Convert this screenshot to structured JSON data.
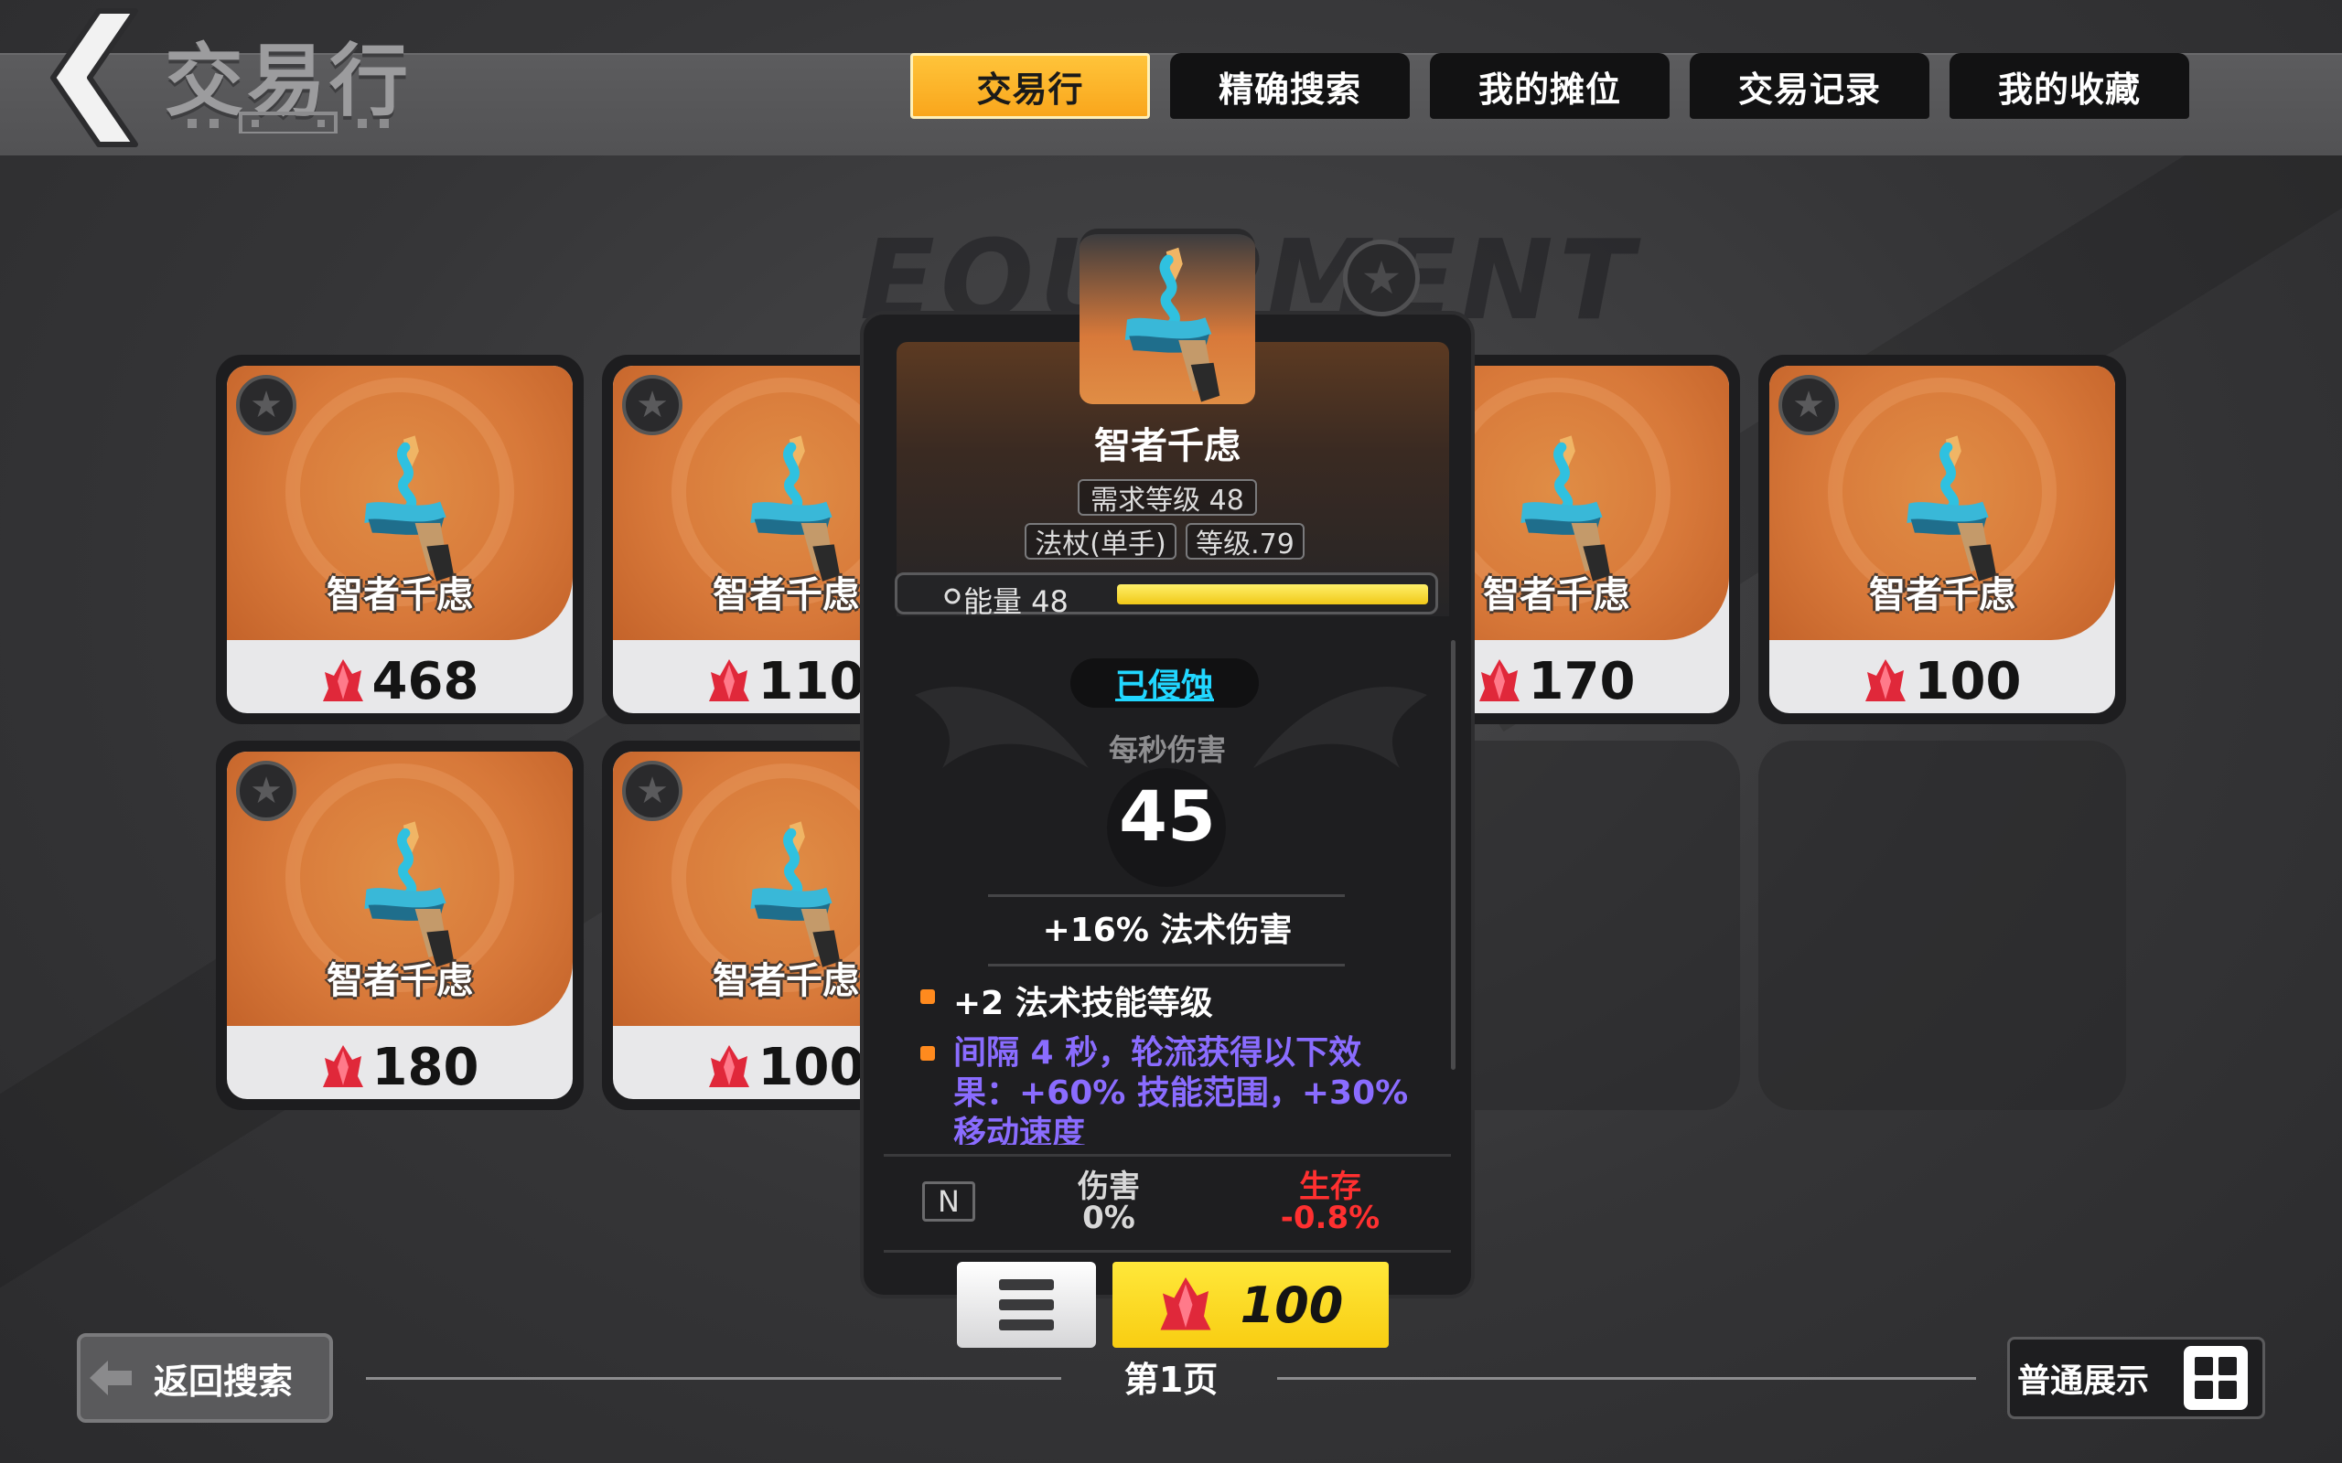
{
  "header": {
    "title": "交易行",
    "tabs": [
      {
        "label": "交易行",
        "active": true
      },
      {
        "label": "精确搜索",
        "active": false
      },
      {
        "label": "我的摊位",
        "active": false
      },
      {
        "label": "交易记录",
        "active": false
      },
      {
        "label": "我的收藏",
        "active": false
      }
    ]
  },
  "listings": [
    {
      "name": "智者千虑",
      "price": "468"
    },
    {
      "name": "智者千虑",
      "price": "110"
    },
    {
      "name": "智者千虑",
      "price": "170"
    },
    {
      "name": "智者千虑",
      "price": "100"
    },
    {
      "name": "智者千虑",
      "price": "180"
    },
    {
      "name": "智者千虑",
      "price": "100"
    }
  ],
  "detail": {
    "watermark": "EQUIPMENT",
    "name": "智者千虑",
    "required_level": "需求等级 48",
    "type": "法杖(单手)",
    "item_level": "等级.79",
    "energy_label": "能量 48",
    "energy_fraction": 0.95,
    "corrupted": "已侵蚀",
    "dps_label": "每秒伤害",
    "dps_value": "45",
    "main_stat": "+16% 法术伤害",
    "affix_1": "+2 法术技能等级",
    "affix_2": "间隔 4 秒，轮流获得以下效果：+60% 技能范围，+30% 移动速度",
    "compare": {
      "badge": "N",
      "damage_label": "伤害",
      "damage_value": "0%",
      "survival_label": "生存",
      "survival_value": "-0.8%"
    },
    "buy_price": "100"
  },
  "footer": {
    "back_search": "返回搜索",
    "page": "第1页",
    "view_mode": "普通展示"
  },
  "colors": {
    "accent": "#f9a61c",
    "corrupt": "#21d7ff",
    "affix_purple": "#8a6cff",
    "negative": "#ff3030",
    "buy": "#f8cd12"
  }
}
